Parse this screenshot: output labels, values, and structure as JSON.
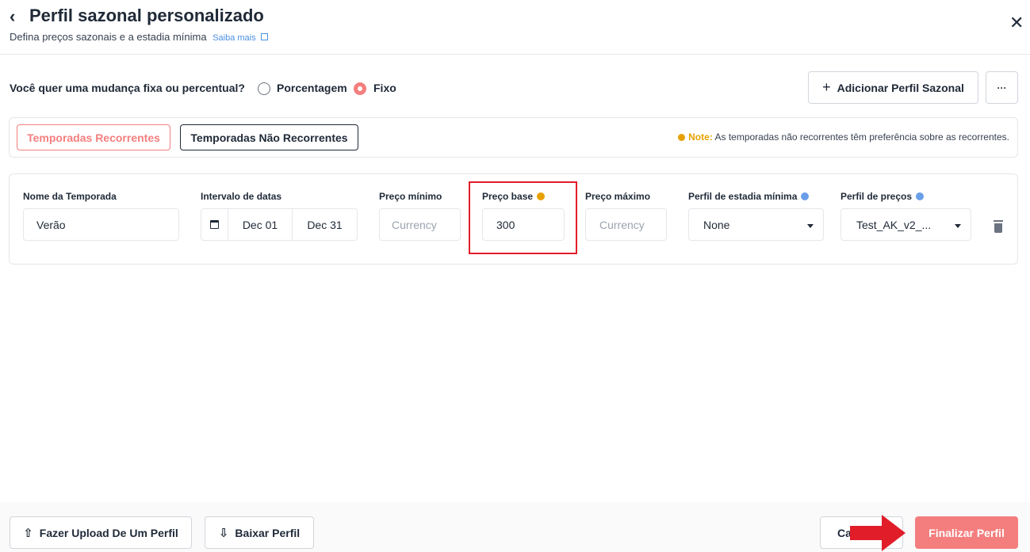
{
  "header": {
    "back_icon": "‹",
    "title": "Perfil sazonal personalizado",
    "subtitle": "Defina preços sazonais e a estadia mínima",
    "learn_more": "Saiba mais",
    "close_icon": "✕"
  },
  "change_type": {
    "question": "Você quer uma mudança fixa ou percentual?",
    "options": [
      "Porcentagem",
      "Fixo"
    ],
    "selected": "Fixo"
  },
  "actions": {
    "add_profile": "Adicionar Perfil Sazonal",
    "more": "···"
  },
  "tabs": {
    "recurring": "Temporadas Recorrentes",
    "non_recurring": "Temporadas Não Recorrentes",
    "active": "Temporadas Recorrentes"
  },
  "note": {
    "label": "Note:",
    "text": "As temporadas não recorrentes têm preferência sobre as recorrentes."
  },
  "season": {
    "labels": {
      "name": "Nome da Temporada",
      "dates": "Intervalo de datas",
      "min_price": "Preço mínimo",
      "base_price": "Preço base",
      "max_price": "Preço máximo",
      "min_stay": "Perfil de estadia mínima",
      "price_profile": "Perfil de preços"
    },
    "name": "Verão",
    "date_start": "Dec 01",
    "date_end": "Dec 31",
    "min_price_placeholder": "Currency",
    "base_price": "300",
    "max_price_placeholder": "Currency",
    "min_stay": "None",
    "price_profile": "Test_AK_v2_..."
  },
  "footer": {
    "upload": "Fazer Upload De Um Perfil",
    "download": "Baixar Perfil",
    "cancel": "Ca",
    "finalize": "Finalizar Perfil"
  },
  "colors": {
    "accent": "#f47e7e",
    "highlight": "#e11d2a",
    "note": "#e6a100",
    "info": "#6a9ee8"
  }
}
